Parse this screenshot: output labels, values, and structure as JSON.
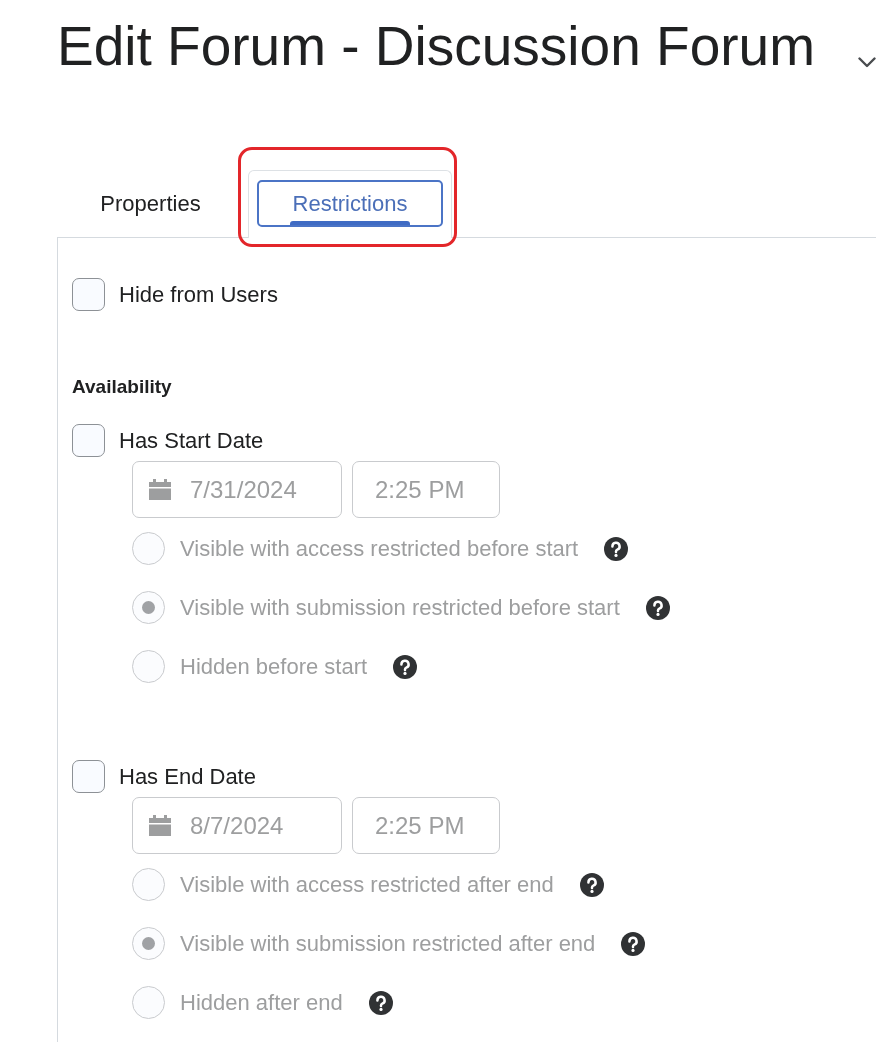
{
  "page": {
    "title": "Edit Forum - Discussion Forum"
  },
  "tabs": [
    {
      "label": "Properties",
      "selected": false,
      "highlighted": false
    },
    {
      "label": "Restrictions",
      "selected": true,
      "highlighted": true
    }
  ],
  "hide_from_users": {
    "label": "Hide from Users",
    "checked": false
  },
  "availability": {
    "heading": "Availability",
    "date_settings": [
      {
        "label": "Has Start Date",
        "checked": false,
        "disabled": true,
        "date": "7/31/2024",
        "time": "2:25 PM",
        "options": [
          {
            "label": "Visible with access restricted before start",
            "selected": false
          },
          {
            "label": "Visible with submission restricted before start",
            "selected": true
          },
          {
            "label": "Hidden before start",
            "selected": false
          }
        ]
      },
      {
        "label": "Has End Date",
        "checked": false,
        "disabled": true,
        "date": "8/7/2024",
        "time": "2:25 PM",
        "options": [
          {
            "label": "Visible with access restricted after end",
            "selected": false
          },
          {
            "label": "Visible with submission restricted after end",
            "selected": true
          },
          {
            "label": "Hidden after end",
            "selected": false
          }
        ]
      }
    ]
  }
}
